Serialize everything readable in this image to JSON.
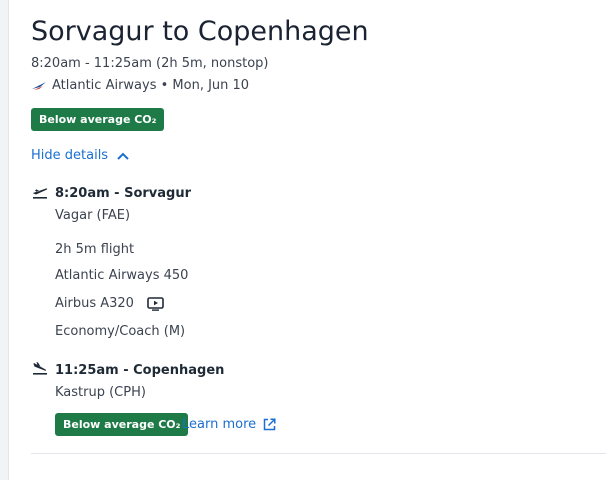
{
  "flight": {
    "title": "Sorvagur to Copenhagen",
    "summary": "8:20am - 11:25am (2h 5m, nonstop)",
    "airline_date": "Atlantic Airways • Mon, Jun 10",
    "co2_badge": "Below average CO₂",
    "hide_details": "Hide details"
  },
  "departure": {
    "time_city": "8:20am - Sorvagur",
    "airport": "Vagar (FAE)"
  },
  "details": {
    "duration": "2h 5m flight",
    "flight_number": "Atlantic Airways 450",
    "aircraft": "Airbus A320",
    "cabin": "Economy/Coach (M)"
  },
  "arrival": {
    "time_city": "11:25am - Copenhagen",
    "airport": "Kastrup (CPH)"
  },
  "footer": {
    "co2_badge": "Below average CO₂",
    "learn_more": "Learn more"
  },
  "colors": {
    "badge_green": "#1e7a46",
    "link_blue": "#1a6fd1",
    "text_dark": "#1b2333"
  },
  "icons": {
    "airline_logo": "atlantic-airways-logo",
    "departure": "takeoff-icon",
    "arrival": "landing-icon",
    "entertainment": "video-screen-icon",
    "chevron": "chevron-up-icon",
    "external": "external-link-icon"
  }
}
